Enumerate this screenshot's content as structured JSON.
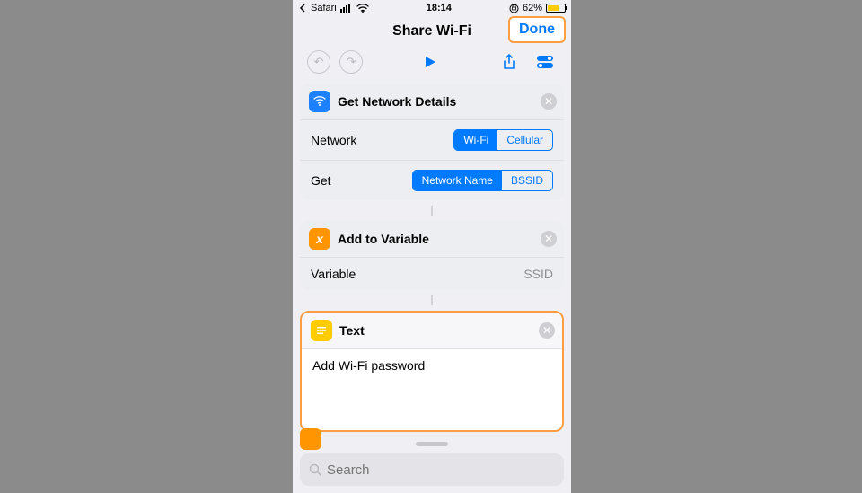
{
  "statusbar": {
    "app": "Safari",
    "time": "18:14",
    "battery_pct": "62%"
  },
  "nav": {
    "title": "Share Wi-Fi",
    "done": "Done"
  },
  "cards": {
    "networkDetails": {
      "title": "Get Network Details",
      "rowNetwork": "Network",
      "segNetwork": {
        "wifi": "Wi-Fi",
        "cellular": "Cellular"
      },
      "rowGet": "Get",
      "segGet": {
        "name": "Network Name",
        "bssid": "BSSID"
      }
    },
    "addVar": {
      "title": "Add to Variable",
      "rowLabel": "Variable",
      "value": "SSID"
    },
    "text": {
      "title": "Text",
      "body": "Add Wi-Fi password"
    }
  },
  "search": {
    "placeholder": "Search"
  }
}
